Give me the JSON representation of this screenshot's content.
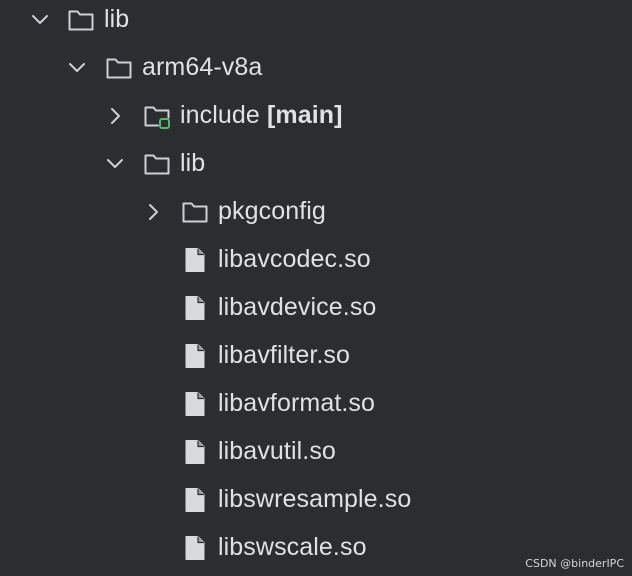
{
  "tree": {
    "lib_root": {
      "label": "lib",
      "expanded": true,
      "icon": "folder-icon"
    },
    "arm64": {
      "label": "arm64-v8a",
      "expanded": true,
      "icon": "folder-icon"
    },
    "include": {
      "label": "include",
      "tag": "[main]",
      "expanded": false,
      "icon": "folder-vcs-icon",
      "badge_color": "#4fbd6c"
    },
    "lib_sub": {
      "label": "lib",
      "expanded": true,
      "icon": "folder-icon"
    },
    "pkgconfig": {
      "label": "pkgconfig",
      "expanded": false,
      "icon": "folder-icon"
    },
    "files": [
      {
        "label": "libavcodec.so"
      },
      {
        "label": "libavdevice.so"
      },
      {
        "label": "libavfilter.so"
      },
      {
        "label": "libavformat.so"
      },
      {
        "label": "libavutil.so"
      },
      {
        "label": "libswresample.so"
      },
      {
        "label": "libswscale.so"
      }
    ]
  },
  "watermark": "CSDN @binderIPC",
  "colors": {
    "background": "#2b2d30",
    "text": "#dfe1e5",
    "icon_stroke": "#ced0d6",
    "vcs_badge": "#4fbd6c"
  }
}
